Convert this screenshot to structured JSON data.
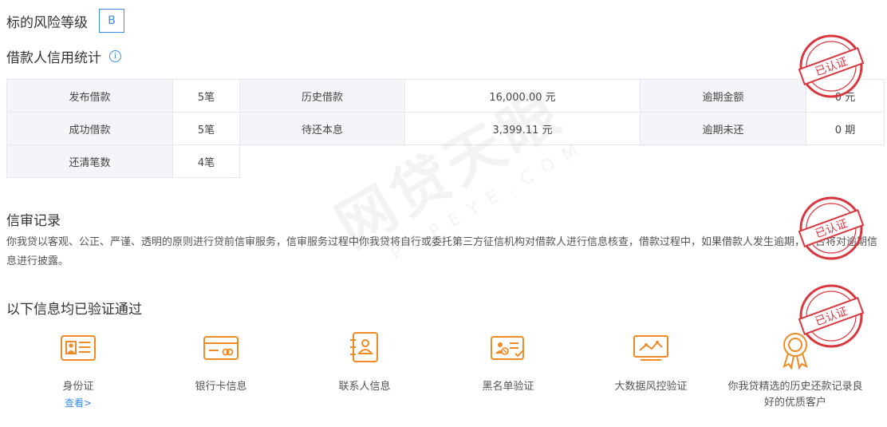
{
  "risk": {
    "title": "标的风险等级",
    "grade": "B"
  },
  "credit": {
    "title": "借款人信用统计",
    "rows": [
      [
        {
          "label": "发布借款",
          "value": "5笔"
        },
        {
          "label": "历史借款",
          "value": "16,000.00 元"
        },
        {
          "label": "逾期金额",
          "value": "0 元"
        }
      ],
      [
        {
          "label": "成功借款",
          "value": "5笔"
        },
        {
          "label": "待还本息",
          "value": "3,399.11 元"
        },
        {
          "label": "逾期未还",
          "value": "0 期"
        }
      ],
      [
        {
          "label": "还清笔数",
          "value": "4笔"
        }
      ]
    ]
  },
  "review": {
    "title": "信审记录",
    "text": "你我贷以客观、公正、严谨、透明的原则进行贷前信审服务，信审服务过程中你我贷将自行或委托第三方征信机构对借款人进行信息核查，借款过程中，如果借款人发生逾期，平台将对逾期信息进行披露。"
  },
  "verified": {
    "title": "以下信息均已验证通过",
    "items": [
      {
        "label": "身份证",
        "link": "查看>",
        "icon": "id-card-icon"
      },
      {
        "label": "银行卡信息",
        "icon": "bank-card-icon"
      },
      {
        "label": "联系人信息",
        "icon": "contacts-book-icon"
      },
      {
        "label": "黑名单验证",
        "icon": "blacklist-check-icon"
      },
      {
        "label": "大数据风控验证",
        "icon": "monitor-chart-icon"
      },
      {
        "label": "你我贷精选的历史还款记录良好的优质客户",
        "icon": "award-ribbon-icon"
      }
    ]
  },
  "stamp": {
    "text": "已认证"
  },
  "watermark": {
    "main": "网贷天眼",
    "sub": "P2PEYE.COM"
  },
  "colors": {
    "accent": "#3a8ee6",
    "icon": "#f08a24",
    "stamp": "#d9363e",
    "label_bg": "#f3f5f8"
  }
}
